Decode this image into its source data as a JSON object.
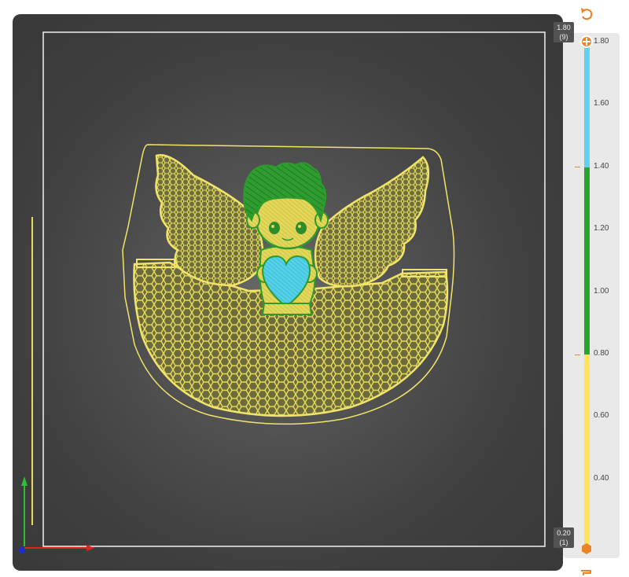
{
  "layer_slider": {
    "max_label": "1.80",
    "max_layer": "(9)",
    "min_label": "0.20",
    "min_layer": "(1)",
    "ticks": [
      "1.80",
      "1.60",
      "1.40",
      "1.20",
      "1.00",
      "0.80",
      "0.60",
      "0.40"
    ],
    "colors": {
      "top_segment": "#5fd3ee",
      "middle_segment": "#2ca32c",
      "bottom_segment": "#ffe35c",
      "handle": "#e8852a"
    }
  },
  "icons": {
    "undo": "undo-arrow-icon",
    "handle_top": "plus-handle-icon",
    "handle_bottom": "hexagon-handle-icon",
    "axis_x": "x-axis-arrow-icon",
    "axis_y": "y-axis-arrow-icon"
  },
  "colors": {
    "infill": "#e7dc57",
    "perimeter": "#f2e46a",
    "hair": "#2c9c2c",
    "heart": "#4fd0e8",
    "bed_border": "#f2f2f2"
  }
}
